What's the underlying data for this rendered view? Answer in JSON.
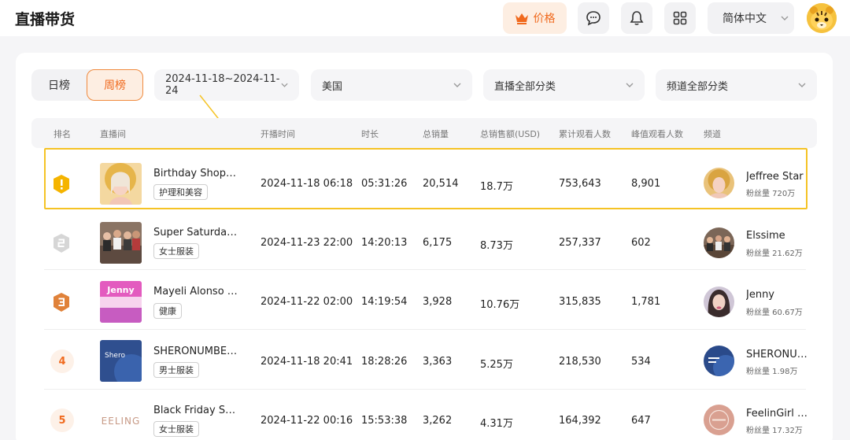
{
  "header": {
    "title": "直播带货",
    "price_label": "价格",
    "language": "简体中文"
  },
  "filters": {
    "day_tab": "日榜",
    "week_tab": "周榜",
    "date_range": "2024-11-18~2024-11-24",
    "country": "美国",
    "live_category": "直播全部分类",
    "channel_category": "频道全部分类"
  },
  "table": {
    "headers": [
      "排名",
      "直播间",
      "开播时间",
      "时长",
      "总销量",
      "总销售额(USD)",
      "累计观看人数",
      "峰值观看人数",
      "频道"
    ],
    "rows": [
      {
        "rank": "1",
        "title": "Birthday Shoppi…",
        "tag": "护理和美容",
        "start": "2024-11-18 06:18",
        "duration": "05:31:26",
        "sales": "20,514",
        "revenue": "18.7万",
        "viewers": "753,643",
        "peak": "8,901",
        "channel": "Jeffree Star",
        "fans": "粉丝量 720万"
      },
      {
        "rank": "2",
        "title": "Super Saturday …",
        "tag": "女士服装",
        "start": "2024-11-23 22:00",
        "duration": "14:20:13",
        "sales": "6,175",
        "revenue": "8.73万",
        "viewers": "257,337",
        "peak": "602",
        "channel": "Elssime",
        "fans": "粉丝量 21.62万"
      },
      {
        "rank": "3",
        "title": "Mayeli Alonso y …",
        "tag": "健康",
        "start": "2024-11-22 02:00",
        "duration": "14:19:54",
        "sales": "3,928",
        "revenue": "10.76万",
        "viewers": "315,835",
        "peak": "1,781",
        "channel": "Jenny",
        "fans": "粉丝量 60.67万"
      },
      {
        "rank": "4",
        "title": "SHERONUMBERUS",
        "tag": "男士服装",
        "start": "2024-11-18 20:41",
        "duration": "18:28:26",
        "sales": "3,363",
        "revenue": "5.25万",
        "viewers": "218,530",
        "peak": "534",
        "channel": "SHERONUM…",
        "fans": "粉丝量 1.98万"
      },
      {
        "rank": "5",
        "title": "Black Friday Sal…",
        "tag": "女士服装",
        "start": "2024-11-22 00:16",
        "duration": "15:53:38",
        "sales": "3,262",
        "revenue": "4.31万",
        "viewers": "164,392",
        "peak": "647",
        "channel": "FeelinGirl LLC",
        "fans": "粉丝量 17.32万"
      }
    ]
  },
  "thumb_text": {
    "jenny": "Jenny",
    "shero": "Shero",
    "feeling": "EELING"
  },
  "colors": {
    "accent": "#f06a1e",
    "highlight": "#f5c325",
    "gold": "#f5b400",
    "silver": "#bdbdbd",
    "bronze": "#e0823a"
  }
}
